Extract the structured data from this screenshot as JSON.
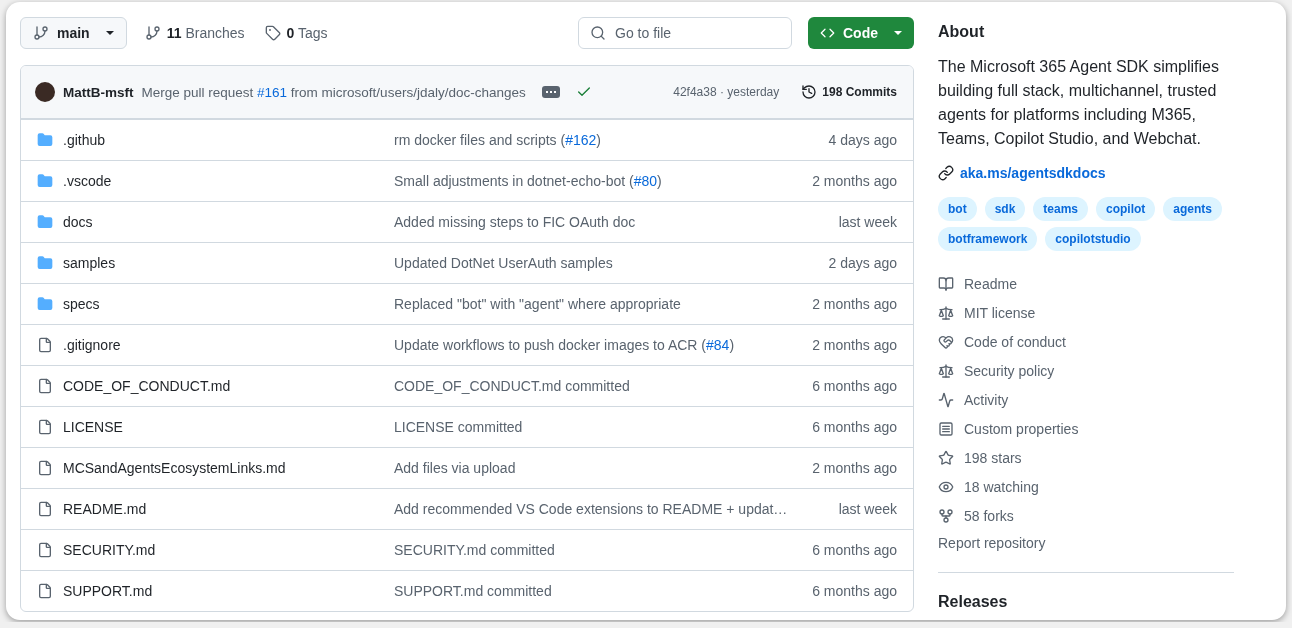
{
  "toolbar": {
    "branch": "main",
    "branches_count": "11",
    "branches_label": "Branches",
    "tags_count": "0",
    "tags_label": "Tags",
    "search": {
      "placeholder": "Go to file"
    },
    "code_button": "Code"
  },
  "latest_commit": {
    "author": "MattB-msft",
    "message": [
      {
        "kind": "text",
        "text": "Merge pull request "
      },
      {
        "kind": "link",
        "text": "#161"
      },
      {
        "kind": "text",
        "text": " from microsoft/users/jdaly/doc-changes"
      }
    ],
    "checks_passed": true,
    "hash": "42f4a38 · yesterday",
    "commits_count": "198",
    "commits_label": "Commits"
  },
  "files": [
    {
      "kind": "folder",
      "name": ".github",
      "message": [
        {
          "kind": "text",
          "text": "rm docker files and scripts ("
        },
        {
          "kind": "link",
          "text": "#162"
        },
        {
          "kind": "text",
          "text": ")"
        }
      ],
      "time": "4 days ago"
    },
    {
      "kind": "folder",
      "name": ".vscode",
      "message": [
        {
          "kind": "text",
          "text": "Small adjustments in dotnet-echo-bot ("
        },
        {
          "kind": "link",
          "text": "#80"
        },
        {
          "kind": "text",
          "text": ")"
        }
      ],
      "time": "2 months ago"
    },
    {
      "kind": "folder",
      "name": "docs",
      "message": [
        {
          "kind": "text",
          "text": "Added missing steps to FIC OAuth doc"
        }
      ],
      "time": "last week"
    },
    {
      "kind": "folder",
      "name": "samples",
      "message": [
        {
          "kind": "text",
          "text": "Updated DotNet UserAuth samples"
        }
      ],
      "time": "2 days ago"
    },
    {
      "kind": "folder",
      "name": "specs",
      "message": [
        {
          "kind": "text",
          "text": "Replaced \"bot\" with \"agent\" where appropriate"
        }
      ],
      "time": "2 months ago"
    },
    {
      "kind": "file",
      "name": ".gitignore",
      "message": [
        {
          "kind": "text",
          "text": "Update workflows to push docker images to ACR ("
        },
        {
          "kind": "link",
          "text": "#84"
        },
        {
          "kind": "text",
          "text": ")"
        }
      ],
      "time": "2 months ago"
    },
    {
      "kind": "file",
      "name": "CODE_OF_CONDUCT.md",
      "message": [
        {
          "kind": "text",
          "text": "CODE_OF_CONDUCT.md committed"
        }
      ],
      "time": "6 months ago"
    },
    {
      "kind": "file",
      "name": "LICENSE",
      "message": [
        {
          "kind": "text",
          "text": "LICENSE committed"
        }
      ],
      "time": "6 months ago"
    },
    {
      "kind": "file",
      "name": "MCSandAgentsEcosystemLinks.md",
      "message": [
        {
          "kind": "text",
          "text": "Add files via upload"
        }
      ],
      "time": "2 months ago"
    },
    {
      "kind": "file",
      "name": "README.md",
      "message": [
        {
          "kind": "text",
          "text": "Add recommended VS Code extensions to README + updat…"
        }
      ],
      "time": "last week"
    },
    {
      "kind": "file",
      "name": "SECURITY.md",
      "message": [
        {
          "kind": "text",
          "text": "SECURITY.md committed"
        }
      ],
      "time": "6 months ago"
    },
    {
      "kind": "file",
      "name": "SUPPORT.md",
      "message": [
        {
          "kind": "text",
          "text": "SUPPORT.md committed"
        }
      ],
      "time": "6 months ago"
    }
  ],
  "about": {
    "title": "About",
    "description": "The Microsoft 365 Agent SDK simplifies building full stack, multichannel, trusted agents for platforms including M365, Teams, Copilot Studio, and Webchat.",
    "link": "aka.ms/agentsdkdocs",
    "topics": [
      "bot",
      "sdk",
      "teams",
      "copilot",
      "agents",
      "botframework",
      "copilotstudio"
    ],
    "items": [
      {
        "kind": "readme",
        "label": "Readme"
      },
      {
        "kind": "license",
        "label": "MIT license"
      },
      {
        "kind": "conduct",
        "label": "Code of conduct"
      },
      {
        "kind": "security",
        "label": "Security policy"
      },
      {
        "kind": "activity",
        "label": "Activity"
      },
      {
        "kind": "properties",
        "label": "Custom properties"
      },
      {
        "kind": "stars",
        "label": "198 stars"
      },
      {
        "kind": "watching",
        "label": "18 watching"
      },
      {
        "kind": "forks",
        "label": "58 forks"
      }
    ],
    "report": "Report repository"
  },
  "releases": {
    "title": "Releases"
  }
}
